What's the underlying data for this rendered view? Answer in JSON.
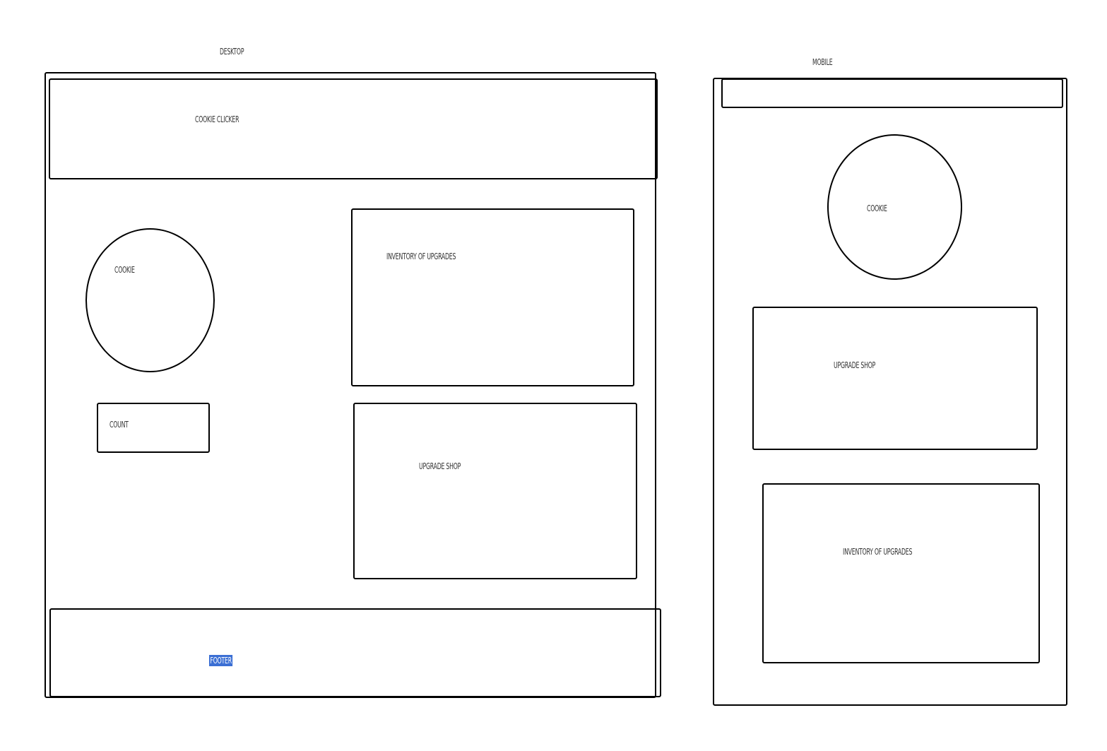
{
  "desktop": {
    "title": "DESKTOP",
    "header_label": "COOKIE CLICKER",
    "cookie_label": "COOKIE",
    "count_label": "COUNT",
    "inventory_label": "INVENTORY OF UPGRADES",
    "shop_label": "UPGRADE SHOP",
    "footer_label": "FOOTER"
  },
  "mobile": {
    "title": "MOBILE",
    "cookie_label": "COOKIE",
    "shop_label": "UPGRADE SHOP",
    "inventory_label": "INVENTORY OF UPGRADES"
  },
  "colors": {
    "stroke": "#000000",
    "selection_highlight": "#3b6fd4"
  }
}
